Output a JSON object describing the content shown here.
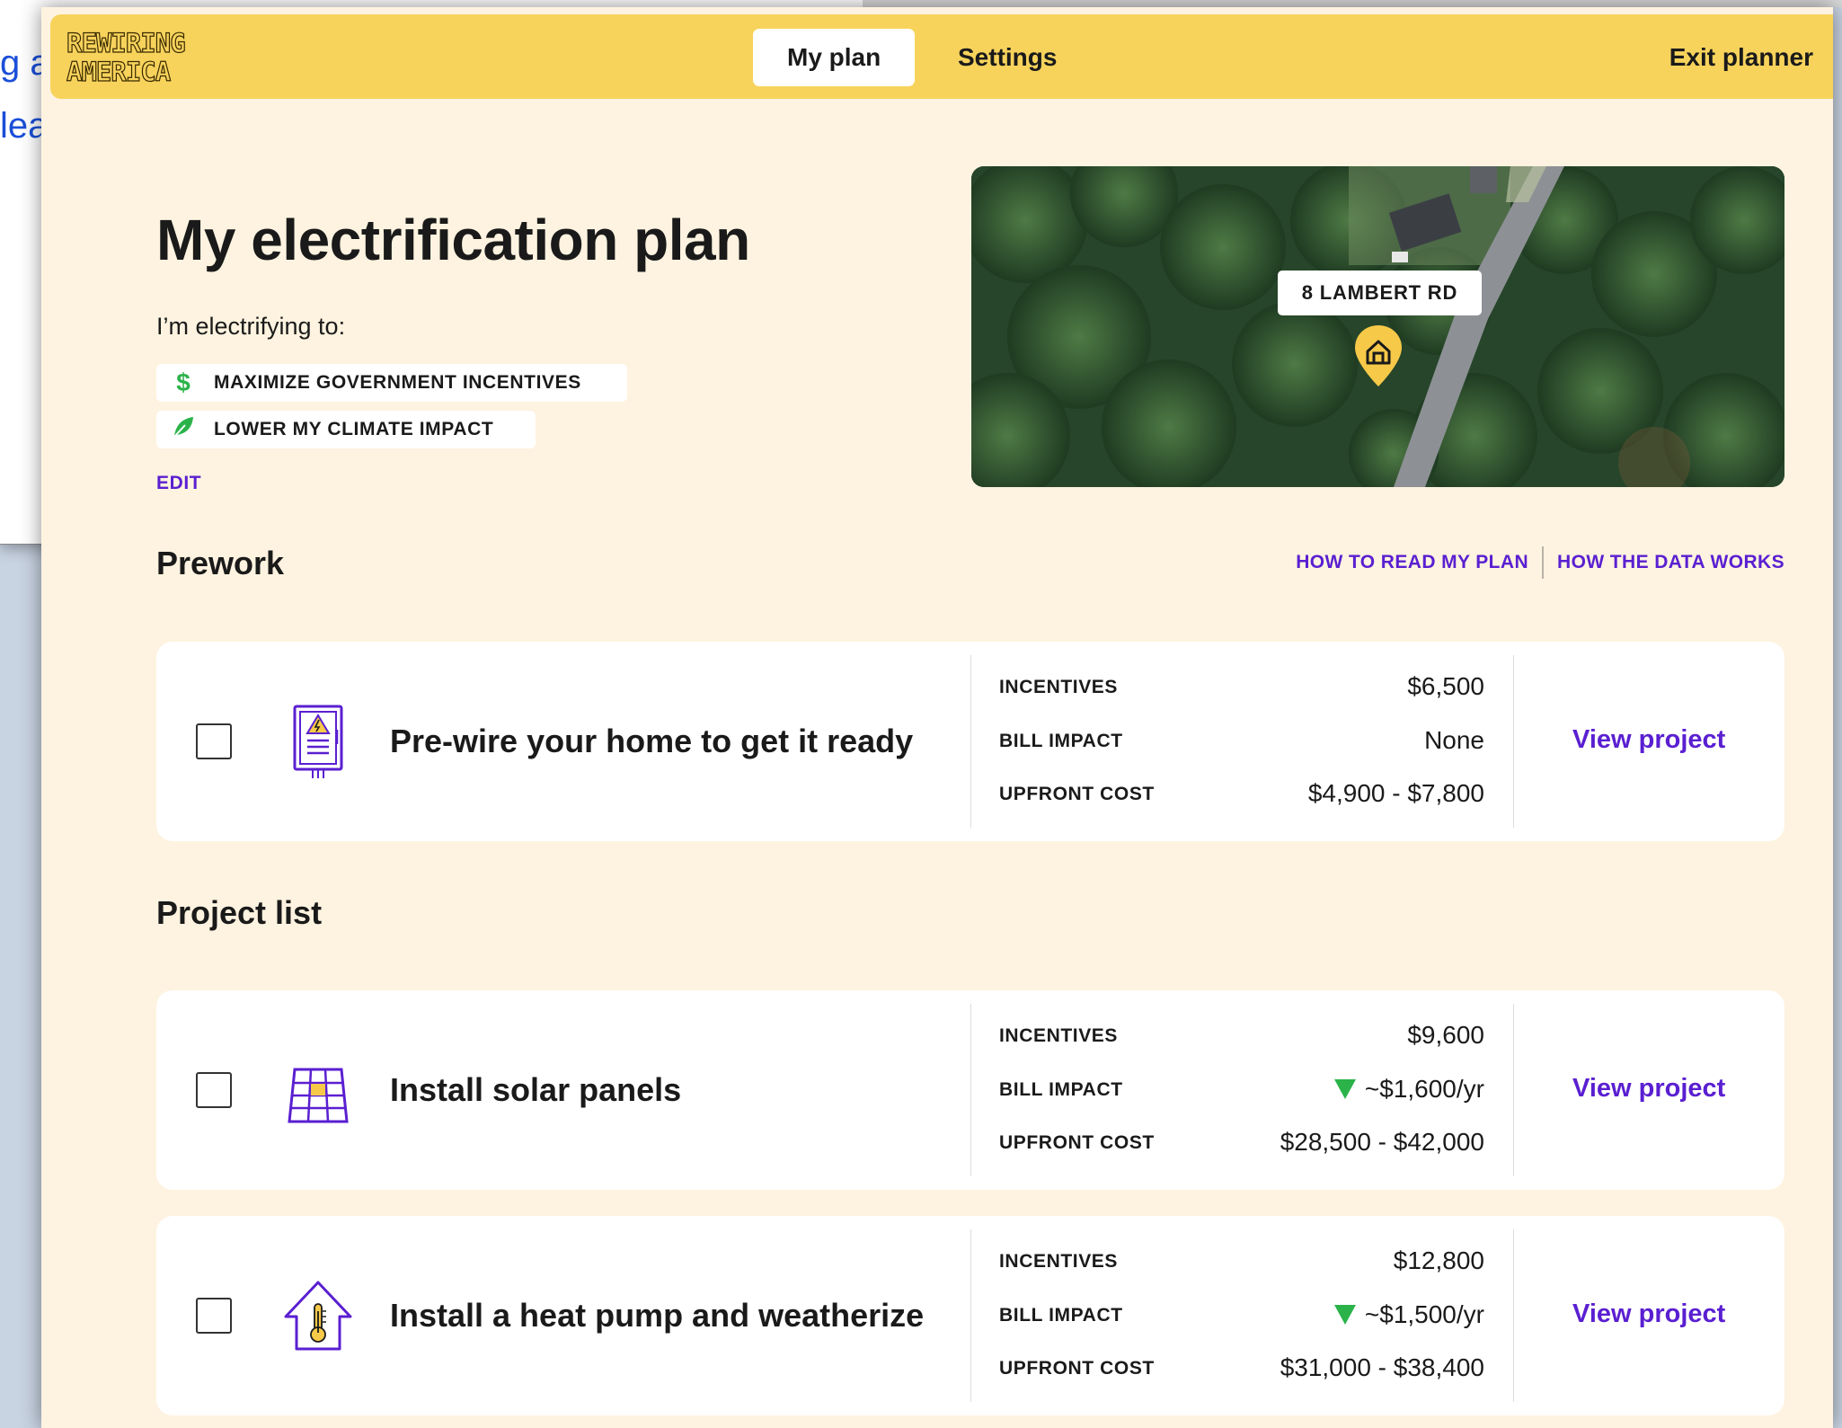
{
  "background": {
    "line1": "g al",
    "line2": "lea"
  },
  "header": {
    "logo_line1": "REWIRING",
    "logo_line2": "AMERICA",
    "tabs": [
      {
        "label": "My plan",
        "active": true
      },
      {
        "label": "Settings",
        "active": false
      }
    ],
    "exit_label": "Exit planner"
  },
  "intro": {
    "title": "My electrification plan",
    "subtitle": "I’m electrifying to:",
    "goals": [
      {
        "icon": "dollar-icon",
        "icon_color": "#2bb34a",
        "label": "MAXIMIZE GOVERNMENT INCENTIVES"
      },
      {
        "icon": "leaf-icon",
        "icon_color": "#2bb34a",
        "label": "LOWER MY CLIMATE IMPACT"
      }
    ],
    "edit_label": "EDIT"
  },
  "map": {
    "address": "8 LAMBERT RD",
    "pin_icon": "home-pin-icon"
  },
  "links": {
    "how_to_read": "HOW TO READ MY PLAN",
    "how_data_works": "HOW THE DATA WORKS"
  },
  "prework": {
    "heading": "Prework",
    "projects": [
      {
        "icon": "electrical-panel-icon",
        "title": "Pre-wire your home to get it ready",
        "incentives_label": "INCENTIVES",
        "incentives": "$6,500",
        "bill_label": "BILL IMPACT",
        "bill_impact": "None",
        "bill_down": false,
        "upfront_label": "UPFRONT COST",
        "upfront": "$4,900 - $7,800",
        "view_label": "View project"
      }
    ]
  },
  "project_list": {
    "heading": "Project list",
    "projects": [
      {
        "icon": "solar-panel-icon",
        "title": "Install solar panels",
        "incentives_label": "INCENTIVES",
        "incentives": "$9,600",
        "bill_label": "BILL IMPACT",
        "bill_impact": "~$1,600/yr",
        "bill_down": true,
        "upfront_label": "UPFRONT COST",
        "upfront": "$28,500 - $42,000",
        "view_label": "View project"
      },
      {
        "icon": "heat-pump-house-icon",
        "title": "Install a heat pump and weatherize",
        "incentives_label": "INCENTIVES",
        "incentives": "$12,800",
        "bill_label": "BILL IMPACT",
        "bill_impact": "~$1,500/yr",
        "bill_down": true,
        "upfront_label": "UPFRONT COST",
        "upfront": "$31,000 - $38,400",
        "view_label": "View project"
      }
    ]
  },
  "colors": {
    "header_bg": "#f7d35c",
    "page_bg": "#fef3e0",
    "link": "#5a1fd1",
    "decrease": "#2bb34a",
    "icon_purple": "#5a1fd1",
    "icon_yellow": "#f7c948"
  }
}
